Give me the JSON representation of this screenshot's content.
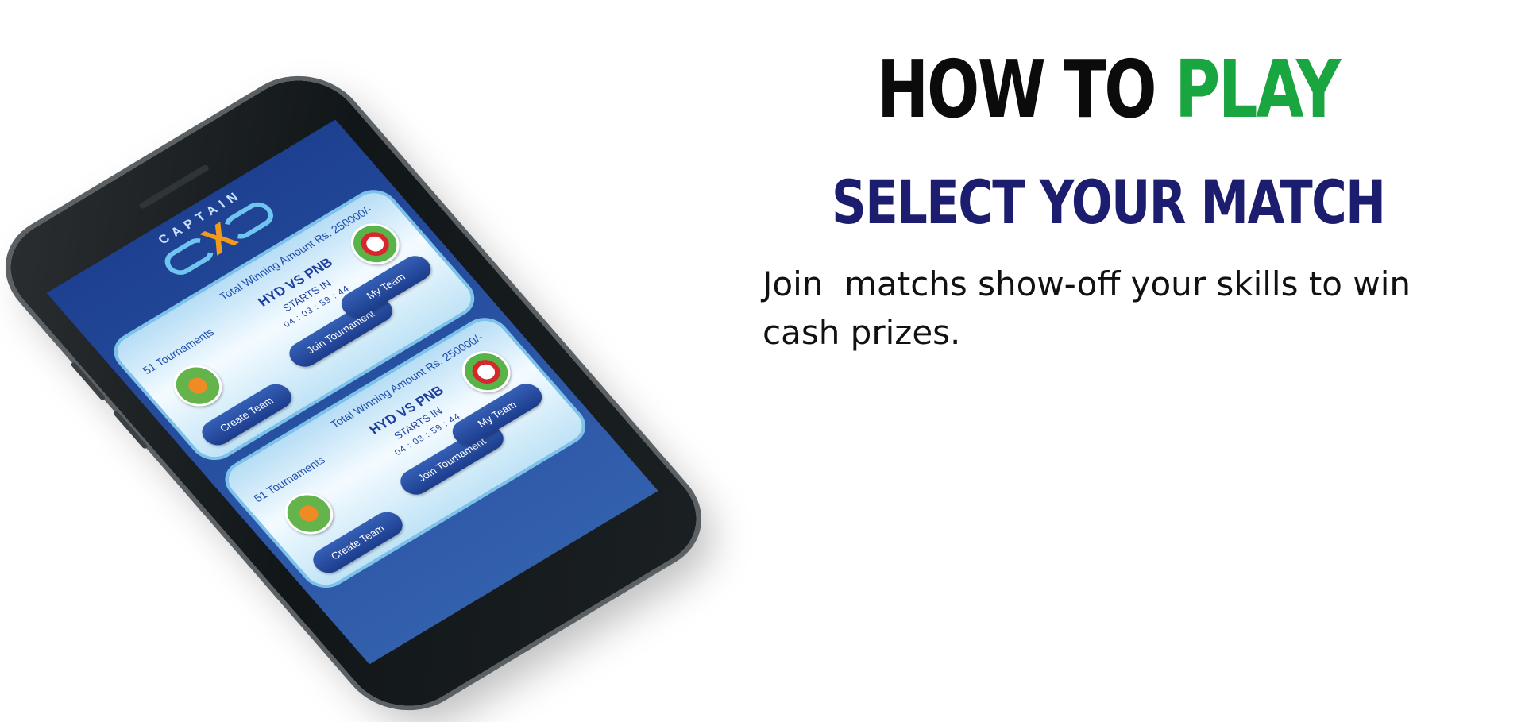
{
  "heading": {
    "part1": "HOW TO",
    "part2": "PLAY"
  },
  "subheading": "SELECT YOUR MATCH",
  "description": "Join  matchs show-off your skills to win cash prizes.",
  "colors": {
    "heading_dark": "#0b0b0b",
    "heading_accent": "#19a540",
    "subheading": "#1c1d6e",
    "screen_blue": "#2a54a5"
  },
  "phone": {
    "app_logo": {
      "word": "CAPTAIN",
      "mark": "X"
    },
    "cards": [
      {
        "amount": "Total Winning Amount Rs. 250000/-",
        "tournaments": "51 Tournaments",
        "match": "HYD VS PNB",
        "starts_label": "STARTS IN",
        "timer": "04 : 03 : 59 : 44",
        "buttons": {
          "create": "Create Team",
          "join": "Join Tournament",
          "my_team": "My Team"
        }
      },
      {
        "amount": "Total Winning Amount Rs. 250000/-",
        "tournaments": "51 Tournaments",
        "match": "HYD VS PNB",
        "starts_label": "STARTS IN",
        "timer": "04 : 03 : 59 : 44",
        "buttons": {
          "create": "Create Team",
          "join": "Join Tournament",
          "my_team": "My Team"
        }
      }
    ]
  }
}
